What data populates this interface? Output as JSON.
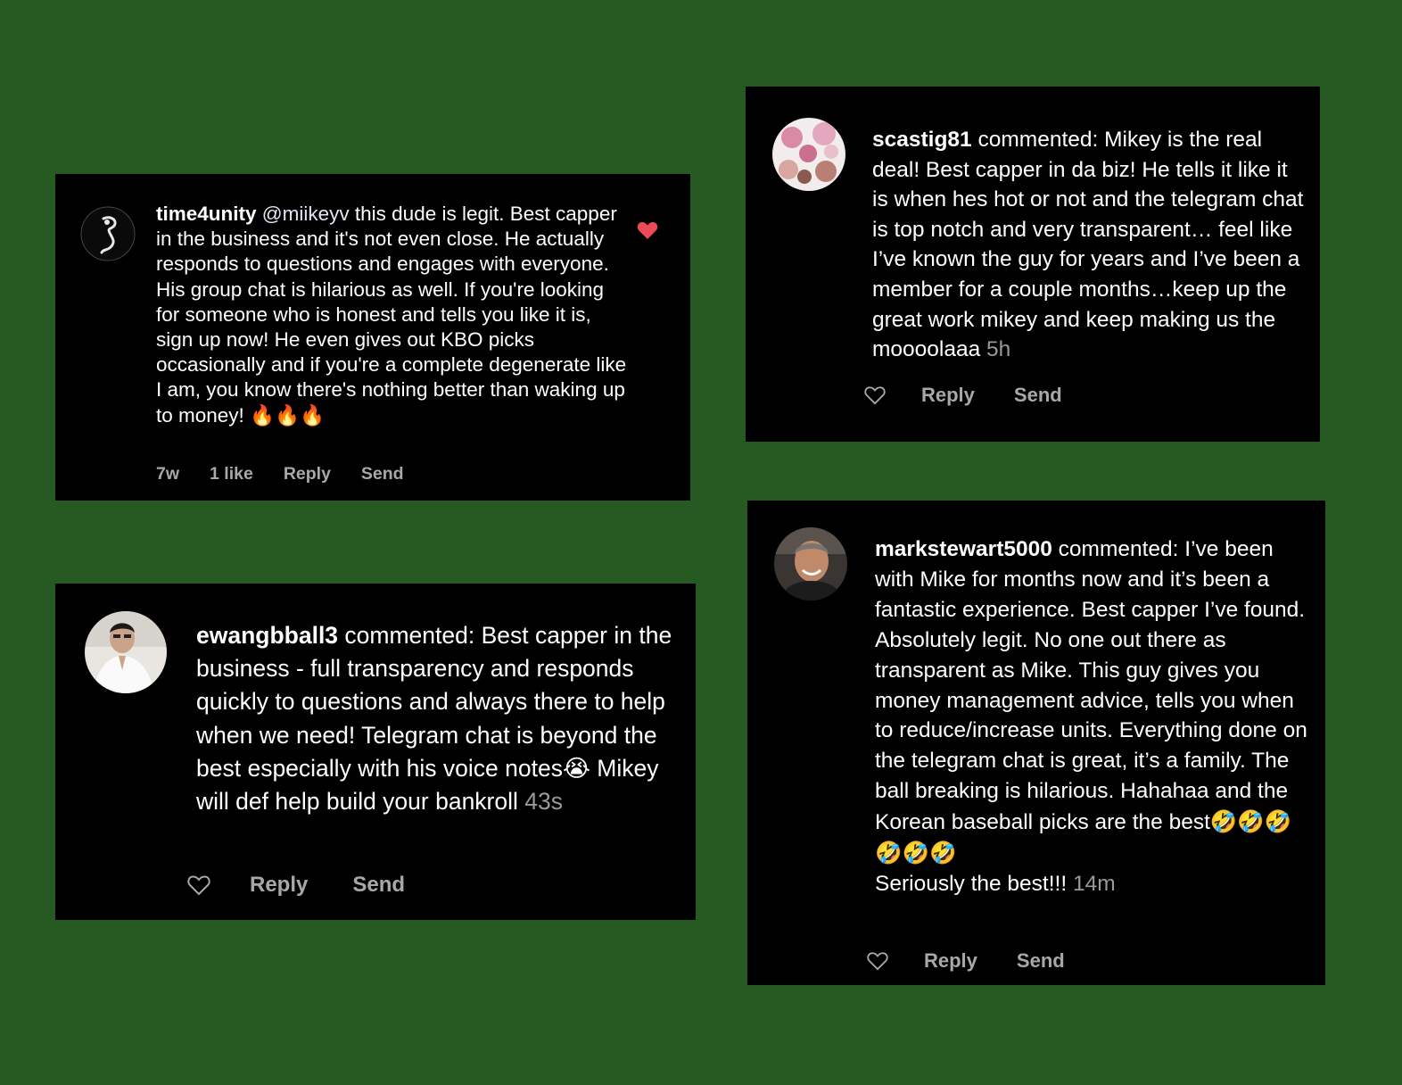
{
  "colors": {
    "background": "#275a22",
    "card": "#000000",
    "text": "#ffffff",
    "muted": "#a8a8a8",
    "like_red": "#ed4956"
  },
  "comments": [
    {
      "username": "time4unity",
      "mention": "@miikeyv",
      "text": " this dude is legit. Best capper in the business and it's not even close. He actually responds to questions and engages with everyone. His group chat is hilarious as well. If you're looking for someone who is honest and tells you like it is, sign up now! He even gives out KBO picks occasionally and if you're a complete degenerate like I am, you know there's nothing better than waking up to money! ",
      "emojis": "🔥🔥🔥",
      "time": "7w",
      "likes": "1 like",
      "reply": "Reply",
      "send": "Send",
      "liked": true
    },
    {
      "username": "ewangbball3",
      "text": " commented: Best capper in the business - full transparency and responds quickly to questions and always there to help when we need! Telegram chat is beyond the best especially with his voice notes",
      "emoji": "😭",
      "text2": " Mikey will def help build your bankroll",
      "time": "43s",
      "reply": "Reply",
      "send": "Send"
    },
    {
      "username": "scastig81",
      "text": " commented: Mikey is the real deal! Best capper in da biz! He tells it like it is when hes hot or not and the telegram chat is top notch and very transparent… feel like I’ve known the guy for years and I’ve been a member for a couple months…keep up the great work mikey and keep making us the moooolaaa",
      "time": "5h",
      "reply": "Reply",
      "send": "Send"
    },
    {
      "username": "markstewart5000",
      "text": " commented: I’ve been with Mike for months now and it’s been a fantastic experience.  Best capper I’ve found. Absolutely legit.  No one out there as transparent as Mike.  This guy gives you money management advice, tells you when to reduce/increase units. Everything done on the telegram chat is great, it’s a family.  The ball breaking is hilarious.  Hahahaa and the Korean baseball picks are the  best",
      "emojis": "🤣🤣🤣🤣🤣🤣",
      "text2": "Seriously the best!!!",
      "time": "14m",
      "reply": "Reply",
      "send": "Send"
    }
  ]
}
